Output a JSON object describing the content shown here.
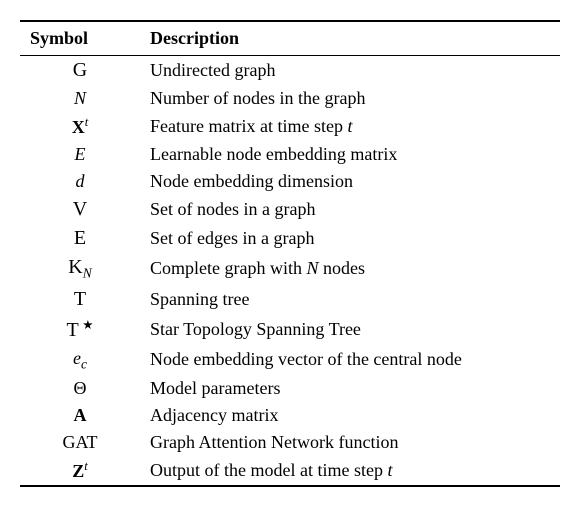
{
  "headers": {
    "symbol": "Symbol",
    "description": "Description"
  },
  "rows": [
    {
      "symbol_html": "<span class='cal'>G</span>",
      "description": "Undirected graph"
    },
    {
      "symbol_html": "<span class='it'>N</span>",
      "description": "Number of nodes in the graph"
    },
    {
      "symbol_html": "<span class='bold rm'>X</span><sup><span class='it'>t</span></sup>",
      "description": "Feature matrix at time step <span class='it'>t</span>"
    },
    {
      "symbol_html": "<span class='it'>E</span>",
      "description": "Learnable node embedding matrix"
    },
    {
      "symbol_html": "<span class='it'>d</span>",
      "description": "Node embedding dimension"
    },
    {
      "symbol_html": "<span class='cal'>V</span>",
      "description": "Set of nodes in a graph"
    },
    {
      "symbol_html": "<span class='cal'>E</span>",
      "description": "Set of edges in a graph"
    },
    {
      "symbol_html": "<span class='cal'>K</span><sub><span class='it'>N</span></sub>",
      "description": "Complete graph with <span class='it'>N</span> nodes"
    },
    {
      "symbol_html": "<span class='cal'>T</span>",
      "description": "Spanning tree"
    },
    {
      "symbol_html": "<span class='cal'>T</span>&thinsp;<sup>&#9733;</sup>",
      "description": "Star Topology Spanning Tree"
    },
    {
      "symbol_html": "<span class='it'>e<sub>c</sub></span>",
      "description": "Node embedding vector of the central node"
    },
    {
      "symbol_html": "&Theta;",
      "description": "Model parameters"
    },
    {
      "symbol_html": "<span class='bold rm'>A</span>",
      "description": "Adjacency matrix"
    },
    {
      "symbol_html": "GAT",
      "description": "Graph Attention Network function"
    },
    {
      "symbol_html": "<span class='bold rm'>Z</span><sup><span class='it'>t</span></sup>",
      "description": "Output of the model at time step <span class='it'>t</span>"
    }
  ]
}
